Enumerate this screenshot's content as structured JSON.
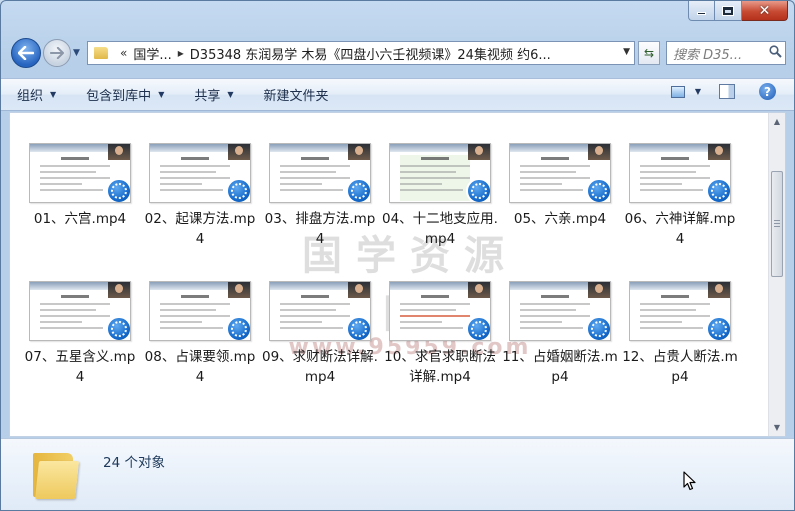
{
  "window": {
    "close_glyph": "✕"
  },
  "nav": {
    "crumb_overflow": "«",
    "crumb_sep": "▸",
    "crumbs": [
      "国学...",
      "D35348 东润易学 木易《四盘小六壬视频课》24集视频 约6..."
    ],
    "search_placeholder": "搜索 D35..."
  },
  "toolbar": {
    "organize": "组织",
    "include_library": "包含到库中",
    "share": "共享",
    "new_folder": "新建文件夹",
    "help": "?"
  },
  "watermark": {
    "line1": "国学资源网",
    "line2": "www.95959.com"
  },
  "files": [
    {
      "name": "01、六宫.mp4",
      "style": "plain"
    },
    {
      "name": "02、起课方法.mp4",
      "style": "plain"
    },
    {
      "name": "03、排盘方法.mp4",
      "style": "plain"
    },
    {
      "name": "04、十二地支应用.mp4",
      "style": "green"
    },
    {
      "name": "05、六亲.mp4",
      "style": "plain"
    },
    {
      "name": "06、六神详解.mp4",
      "style": "plain"
    },
    {
      "name": "07、五星含义.mp4",
      "style": "plain"
    },
    {
      "name": "08、占课要领.mp4",
      "style": "plain"
    },
    {
      "name": "09、求财断法详解.mp4",
      "style": "plain"
    },
    {
      "name": "10、求官求职断法详解.mp4",
      "style": "red"
    },
    {
      "name": "11、占婚姻断法.mp4",
      "style": "plain"
    },
    {
      "name": "12、占贵人断法.mp4",
      "style": "plain"
    }
  ],
  "details": {
    "count": "24 个对象"
  },
  "icons": {
    "back": "back-arrow-icon",
    "forward": "forward-arrow-icon",
    "folder": "folder-icon",
    "refresh": "refresh-icon",
    "search": "search-icon",
    "video": "video-player-icon"
  }
}
